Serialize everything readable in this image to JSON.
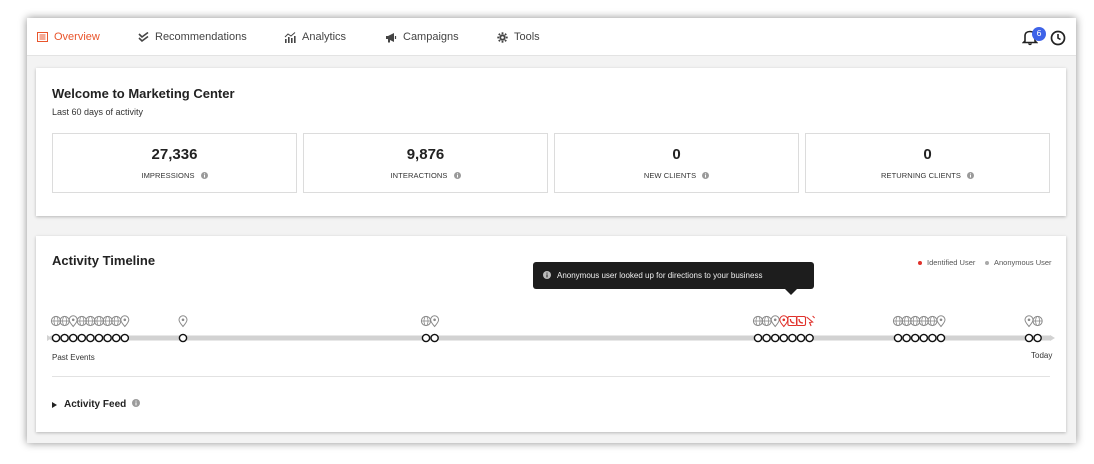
{
  "nav": {
    "items": [
      {
        "label": "Overview",
        "icon": "list-icon",
        "active": true
      },
      {
        "label": "Recommendations",
        "icon": "check-double-icon",
        "active": false
      },
      {
        "label": "Analytics",
        "icon": "analytics-chart-icon",
        "active": false
      },
      {
        "label": "Campaigns",
        "icon": "megaphone-icon",
        "active": false
      },
      {
        "label": "Tools",
        "icon": "gear-icon",
        "active": false
      }
    ],
    "notification_count": "6",
    "accent_color": "#e9552c",
    "badge_color": "#3e63e8"
  },
  "welcome": {
    "title": "Welcome to Marketing Center",
    "subtitle": "Last 60 days of activity",
    "stats": [
      {
        "value": "27,336",
        "label": "IMPRESSIONS"
      },
      {
        "value": "9,876",
        "label": "INTERACTIONS"
      },
      {
        "value": "0",
        "label": "NEW CLIENTS"
      },
      {
        "value": "0",
        "label": "RETURNING CLIENTS"
      }
    ]
  },
  "timeline": {
    "title": "Activity Timeline",
    "legend": {
      "identified": "Identified User",
      "anonymous": "Anonymous User",
      "identified_color": "#e0312b",
      "anonymous_color": "#a9a9a9"
    },
    "tooltip": "Anonymous user looked up for directions to your business",
    "start_label": "Past Events",
    "end_label": "Today",
    "clusters": [
      {
        "events": 9,
        "identified": 0,
        "icons": [
          "globe-icon",
          "globe-icon",
          "map-pin-icon",
          "globe-icon",
          "globe-icon",
          "globe-icon",
          "globe-icon",
          "globe-icon",
          "map-pin-icon"
        ]
      },
      {
        "events": 1,
        "identified": 0,
        "icons": [
          "map-pin-icon"
        ]
      },
      {
        "events": 2,
        "identified": 0,
        "icons": [
          "globe-icon",
          "map-pin-icon"
        ]
      },
      {
        "events": 7,
        "identified": 3,
        "icons": [
          "globe-icon",
          "globe-icon",
          "map-pin-icon",
          "map-pin-icon",
          "phone-icon",
          "phone-icon",
          "click-icon"
        ]
      },
      {
        "events": 6,
        "identified": 0,
        "icons": [
          "globe-icon",
          "globe-icon",
          "globe-icon",
          "globe-icon",
          "globe-icon",
          "map-pin-icon"
        ]
      },
      {
        "events": 2,
        "identified": 0,
        "icons": [
          "map-pin-icon",
          "globe-icon"
        ]
      }
    ]
  },
  "activity_feed": {
    "label": "Activity Feed"
  }
}
